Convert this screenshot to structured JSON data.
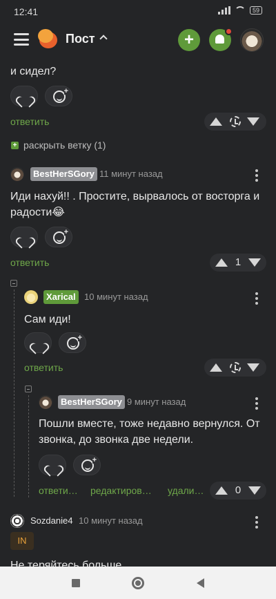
{
  "statusbar": {
    "time": "12:41",
    "battery": "59"
  },
  "appbar": {
    "title": "Пост"
  },
  "comments": [
    {
      "id": "c0",
      "text_tail": "и сидел?",
      "reply": "ответить"
    },
    {
      "expand": "раскрыть ветку (1)"
    },
    {
      "id": "c1",
      "user": "BestHerSGory",
      "time": "11 минут назад",
      "text": "Иди нахуй!! . Простите, вырвалось от восторга и радости😂",
      "reply": "ответить",
      "rating": "1"
    },
    {
      "id": "c2",
      "user": "Xarical",
      "time": "10 минут назад",
      "text": "Сам иди!",
      "reply": "ответить"
    },
    {
      "id": "c3",
      "user": "BestHerSGory",
      "time": "9 минут назад",
      "text": "Пошли вместе, тоже недавно вернулся. От звонка, до звонка две недели.",
      "reply": "ответи…",
      "edit": "редактиров…",
      "delete": "удали…",
      "rating": "0"
    },
    {
      "id": "c4",
      "user": "Sozdanie4",
      "time": "10 минут назад",
      "badge": "IN",
      "text": "Не теряйтесь больше"
    }
  ]
}
